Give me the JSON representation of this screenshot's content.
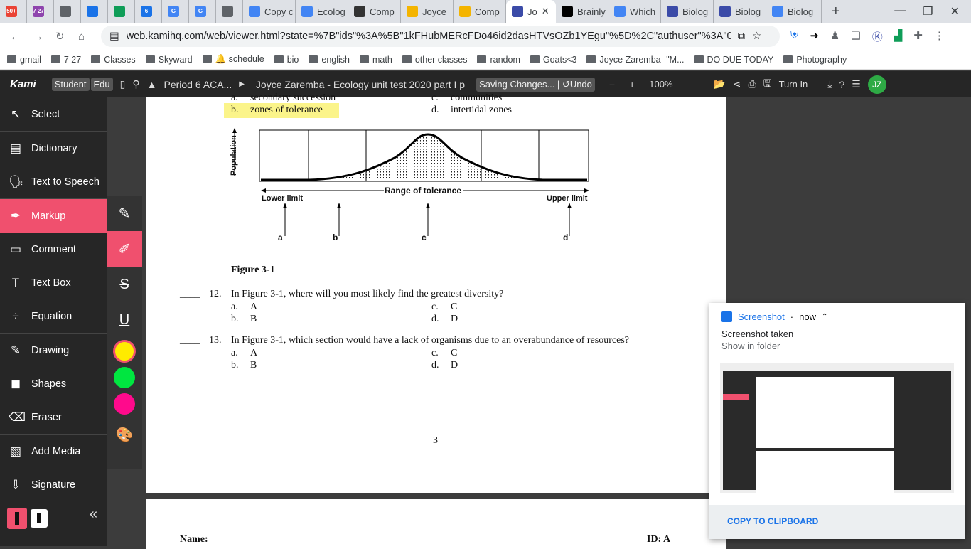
{
  "browser": {
    "tabs": [
      {
        "label": "50+",
        "color": "#ea4335"
      },
      {
        "label": "7 27",
        "color": "#8e44ad"
      },
      {
        "label": "",
        "color": "#5f6368"
      },
      {
        "label": "",
        "color": "#1a73e8"
      },
      {
        "label": "",
        "color": "#0f9d58"
      },
      {
        "label": "6",
        "color": "#1a73e8"
      },
      {
        "label": "G",
        "color": "#4285f4"
      },
      {
        "label": "G",
        "color": "#4285f4"
      },
      {
        "label": "",
        "color": "#5f6368"
      },
      {
        "label": "Copy c",
        "color": "#4285f4"
      },
      {
        "label": "Ecolog",
        "color": "#4285f4"
      },
      {
        "label": "Comp",
        "color": "#333"
      },
      {
        "label": "Joyce",
        "color": "#f4b400"
      },
      {
        "label": "Comp",
        "color": "#f4b400"
      },
      {
        "label": "Jo",
        "color": "#3b4ba8",
        "active": true
      },
      {
        "label": "Brainly",
        "color": "#000"
      },
      {
        "label": "Which",
        "color": "#4285f4"
      },
      {
        "label": "Biolog",
        "color": "#3b4ba8"
      },
      {
        "label": "Biolog",
        "color": "#3b4ba8"
      },
      {
        "label": "Biolog",
        "color": "#4285f4"
      }
    ],
    "url": "web.kamihq.com/web/viewer.html?state=%7B\"ids\"%3A%5B\"1kFHubMERcFDo46id2dasHTVsOZb1YEgu\"%5D%2C\"authuser\"%3A\"0\"%2C\"...",
    "bookmarks": [
      "gmail",
      "7 27",
      "Classes",
      "Skyward",
      "🔔 schedule",
      "bio",
      "english",
      "math",
      "other classes",
      "random",
      "Goats<3",
      "Joyce Zaremba- \"M...",
      "DO DUE TODAY",
      "Photography"
    ]
  },
  "kami": {
    "logo": "Kami",
    "badges": [
      "Student",
      "Edu"
    ],
    "folder": "Period 6 ACA...",
    "doc_title": "Joyce Zaremba - Ecology unit test 2020 part I p",
    "saving": "Saving Changes...",
    "undo": "Undo",
    "zoom": "100%",
    "turn_in": "Turn In",
    "avatar": "JZ"
  },
  "sidebar": [
    "Select",
    "Dictionary",
    "Text to Speech",
    "Markup",
    "Comment",
    "Text Box",
    "Equation",
    "Drawing",
    "Shapes",
    "Eraser",
    "Add Media",
    "Signature"
  ],
  "colors": {
    "accent": "#f0506e",
    "yellow": "#ffeb00",
    "green": "#00e640",
    "magenta": "#ff0a8c"
  },
  "doc": {
    "prev_a": "a.",
    "prev_a_text": "secondary succession",
    "prev_c": "c.",
    "prev_c_text": "communities",
    "prev_b": "b.",
    "prev_b_text": "zones of tolerance",
    "prev_d": "d.",
    "prev_d_text": "intertidal zones",
    "fig_ylabel": "Population",
    "fig_range": "Range of tolerance",
    "fig_lower": "Lower limit",
    "fig_upper": "Upper limit",
    "fig_letters": [
      "a",
      "b",
      "c",
      "d"
    ],
    "fig_caption": "Figure 3-1",
    "questions": [
      {
        "num": "12.",
        "text": "In Figure 3-1, where will you most likely find the greatest diversity?",
        "opts": [
          "a.",
          "A",
          "c.",
          "C",
          "b.",
          "B",
          "d.",
          "D"
        ]
      },
      {
        "num": "13.",
        "text": "In Figure 3-1, which section would have a lack of organisms due to an overabundance of resources?",
        "opts": [
          "a.",
          "A",
          "c.",
          "C",
          "b.",
          "B",
          "d.",
          "D"
        ]
      }
    ],
    "page_num": "3",
    "name_label": "Name:",
    "id_label": "ID: A"
  },
  "notification": {
    "app": "Screenshot",
    "time": "now",
    "title": "Screenshot taken",
    "sub": "Show in folder",
    "action": "COPY TO CLIPBOARD"
  }
}
